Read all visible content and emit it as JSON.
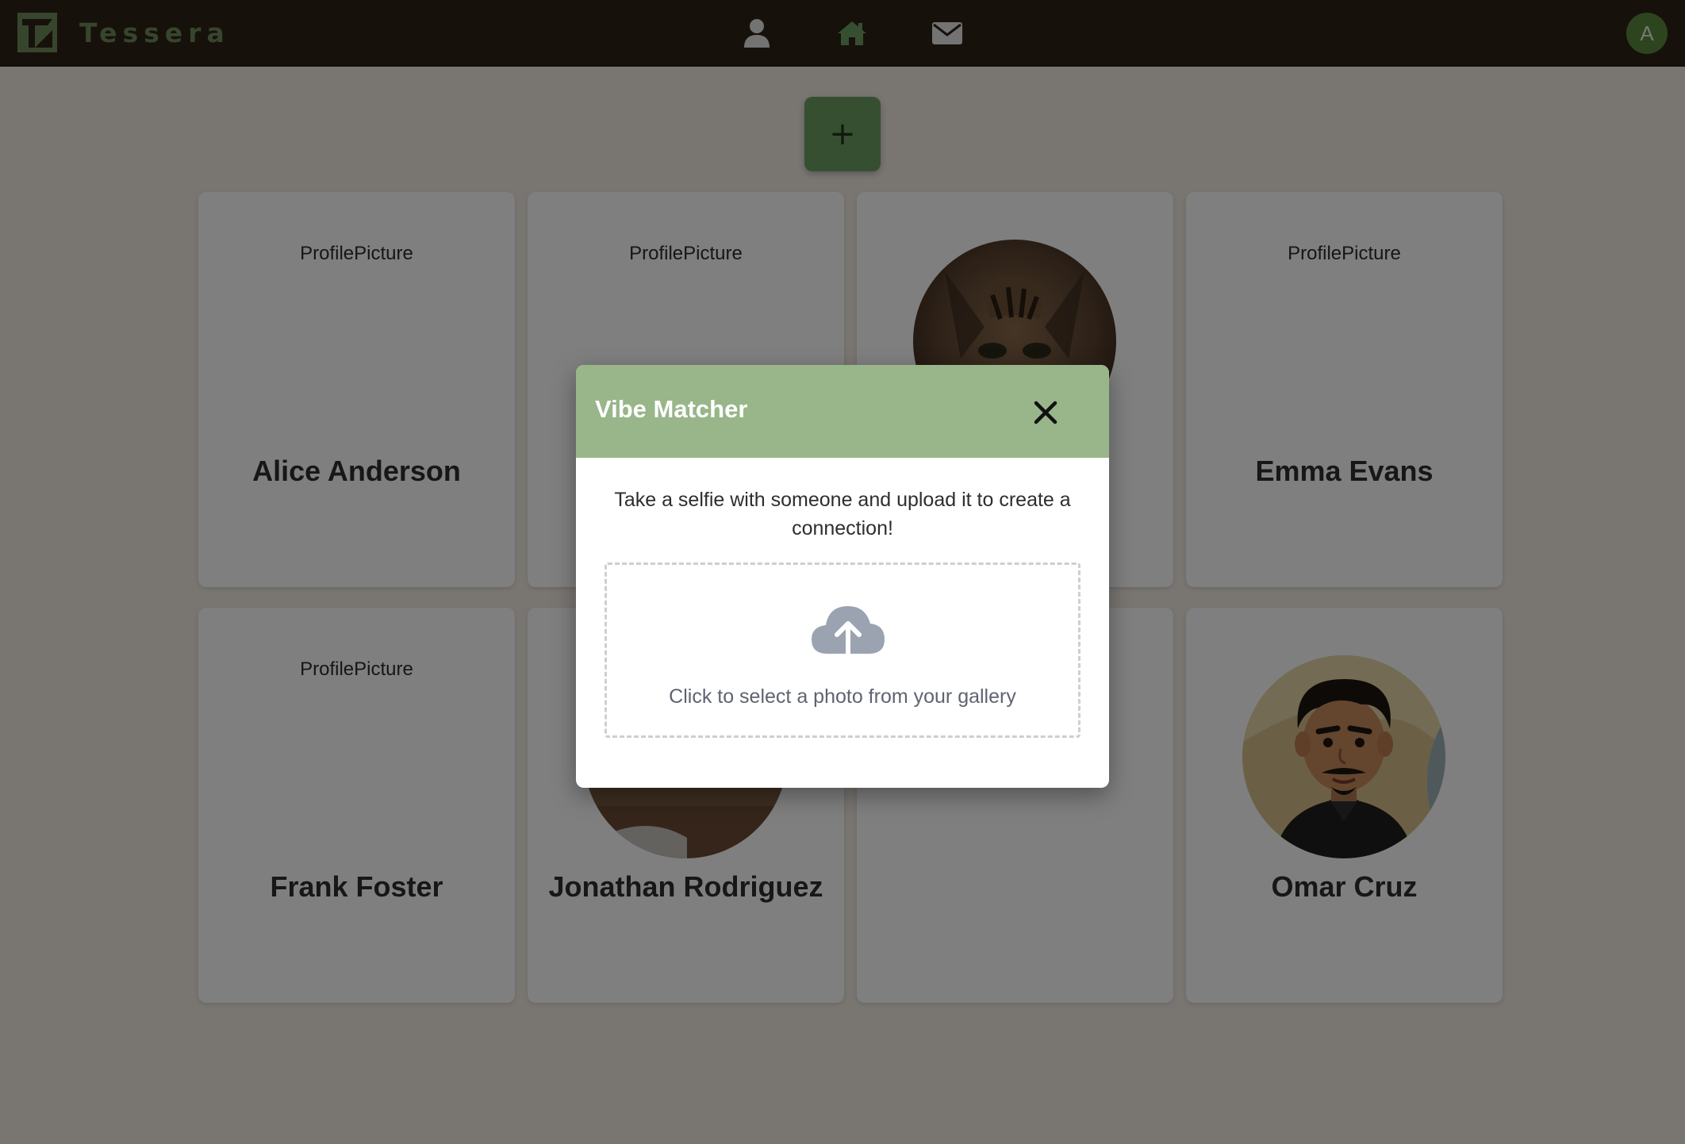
{
  "app": {
    "brand": "Tessera",
    "avatar_initial": "A",
    "accent_color": "#6f9e62",
    "nav": [
      {
        "icon": "user-icon"
      },
      {
        "icon": "home-icon"
      },
      {
        "icon": "mail-icon"
      }
    ]
  },
  "main": {
    "add_label": "+"
  },
  "cards": [
    {
      "name": "Alice Anderson",
      "picture_alt": "ProfilePicture",
      "has_photo": false
    },
    {
      "name": "",
      "picture_alt": "ProfilePicture",
      "has_photo": false
    },
    {
      "name": "",
      "picture_alt": "",
      "has_photo": true,
      "photo": "cat"
    },
    {
      "name": "Emma Evans",
      "picture_alt": "ProfilePicture",
      "has_photo": false
    },
    {
      "name": "Frank Foster",
      "picture_alt": "ProfilePicture",
      "has_photo": false
    },
    {
      "name": "Jonathan Rodriguez",
      "picture_alt": "",
      "has_photo": true,
      "photo": "brown"
    },
    {
      "name": "",
      "picture_alt": "",
      "has_photo": false
    },
    {
      "name": "Omar Cruz",
      "picture_alt": "",
      "has_photo": true,
      "photo": "cartoon-man"
    }
  ],
  "modal": {
    "title": "Vibe Matcher",
    "description": "Take a selfie with someone and upload it to create a connection!",
    "upload_text": "Click to select a photo from your gallery",
    "upload_icon": "cloud-upload-icon",
    "close_icon": "close-icon"
  }
}
